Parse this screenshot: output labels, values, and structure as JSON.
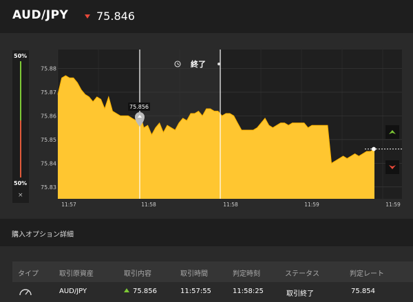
{
  "header": {
    "pair": "AUD/JPY",
    "price": "75.846",
    "direction": "down"
  },
  "gauge": {
    "top_label": "50%",
    "bottom_label": "50%",
    "close": "×"
  },
  "chart_data": {
    "type": "area",
    "y_ticks": [
      "75.88",
      "75.87",
      "75.86",
      "75.85",
      "75.84",
      "75.83"
    ],
    "x_ticks": [
      "11:57",
      "11:58",
      "11:58",
      "11:59",
      "11:59"
    ],
    "ylim": [
      75.825,
      75.888
    ],
    "current_price": 75.846,
    "entry_label": "75.856",
    "expiry_label": "終了",
    "colors": {
      "fill": "#ffc630",
      "line": "#ffb300",
      "background": "#1f1f1f",
      "expiry_panel": "#2a2a2a"
    },
    "series": [
      {
        "values": [
          75.869,
          75.876,
          75.877,
          75.876,
          75.876,
          75.874,
          75.871,
          75.869,
          75.868,
          75.866,
          75.868,
          75.867,
          75.863,
          75.868,
          75.862,
          75.861,
          75.86,
          75.86,
          75.86,
          75.859,
          75.858,
          75.861,
          75.855,
          75.856,
          75.852,
          75.855,
          75.857,
          75.853,
          75.856,
          75.855,
          75.854,
          75.857,
          75.859,
          75.858,
          75.861,
          75.861,
          75.862,
          75.86,
          75.863,
          75.863,
          75.862,
          75.862,
          75.86,
          75.861,
          75.861,
          75.86,
          75.857,
          75.854,
          75.854,
          75.854,
          75.854,
          75.855,
          75.857,
          75.859,
          75.856,
          75.855,
          75.856,
          75.857,
          75.857,
          75.856,
          75.857,
          75.857,
          75.857,
          75.857,
          75.855,
          75.856,
          75.856,
          75.856,
          75.856,
          75.856,
          75.84,
          75.841,
          75.842,
          75.843,
          75.842,
          75.843,
          75.844,
          75.843,
          75.844,
          75.845,
          75.845,
          75.846
        ]
      }
    ]
  },
  "section": {
    "title": "購入オプション詳細"
  },
  "table": {
    "headers": [
      "タイプ",
      "取引原資産",
      "取引内容",
      "取引時間",
      "判定時刻",
      "ステータス",
      "判定レート"
    ],
    "row": {
      "asset": "AUD/JPY",
      "direction": "up",
      "rate": "75.856",
      "time": "11:57:55",
      "judgment_time": "11:58:25",
      "status": "取引終了",
      "judgment_rate": "75.854"
    }
  }
}
